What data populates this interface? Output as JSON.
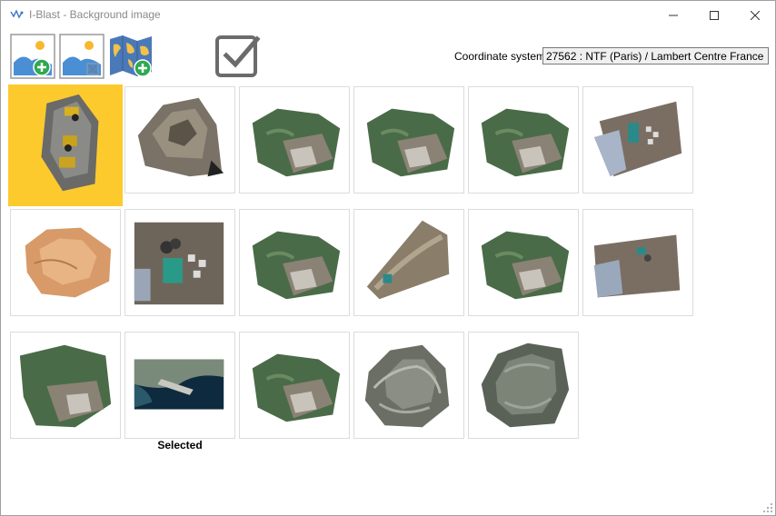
{
  "window": {
    "title": "I-Blast - Background image",
    "app_icon": "iblast-logo-icon"
  },
  "title_buttons": {
    "minimize_icon": "minimize-icon",
    "maximize_icon": "maximize-icon",
    "close_icon": "close-icon"
  },
  "toolbar": {
    "add_image_icon": "add-image-icon",
    "remove_image_icon": "remove-image-icon",
    "add_map_icon": "add-map-icon",
    "validate_icon": "checkbox-icon",
    "color_swatch": "#e04c3a"
  },
  "coordinate_system": {
    "label": "Coordinate system",
    "value": "27562 : NTF (Paris) / Lambert Centre France"
  },
  "images": [
    {
      "id": 1,
      "kind": "drone-vehicles",
      "selected": true
    },
    {
      "id": 2,
      "kind": "quarry-pit-grey"
    },
    {
      "id": 3,
      "kind": "quarry-green"
    },
    {
      "id": 4,
      "kind": "quarry-green"
    },
    {
      "id": 5,
      "kind": "quarry-green"
    },
    {
      "id": 6,
      "kind": "site-tank"
    },
    {
      "id": 7,
      "kind": "terrain-orange"
    },
    {
      "id": 8,
      "kind": "site-tank-square"
    },
    {
      "id": 9,
      "kind": "quarry-green"
    },
    {
      "id": 10,
      "kind": "quarry-slope"
    },
    {
      "id": 11,
      "kind": "quarry-green"
    },
    {
      "id": 12,
      "kind": "site-building"
    },
    {
      "id": 13,
      "kind": "quarry-green-large"
    },
    {
      "id": 14,
      "kind": "satellite-coast",
      "caption": "Selected"
    },
    {
      "id": 15,
      "kind": "quarry-green"
    },
    {
      "id": 16,
      "kind": "mesh-grey"
    },
    {
      "id": 17,
      "kind": "mesh-grey-2"
    }
  ],
  "colors": {
    "selected_tile": "#fdca2e",
    "tile_border": "#dcdcdc",
    "accent_red": "#e04c3a"
  }
}
